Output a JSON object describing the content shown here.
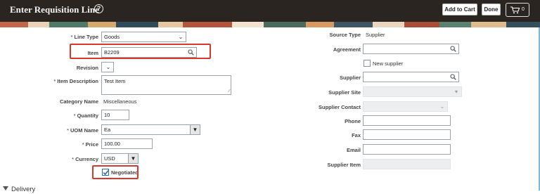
{
  "header": {
    "title": "Enter Requisition Line",
    "add_to_cart": "Add to Cart",
    "done": "Done",
    "cart_count": "0"
  },
  "left": {
    "line_type": {
      "label": "Line Type",
      "value": "Goods"
    },
    "item": {
      "label": "Item",
      "value": "B2209"
    },
    "revision": {
      "label": "Revision",
      "value": ""
    },
    "item_description": {
      "label": "Item Description",
      "value": "Test Item"
    },
    "category_name": {
      "label": "Category Name",
      "value": "Miscellaneous"
    },
    "quantity": {
      "label": "Quantity",
      "value": "10"
    },
    "uom_name": {
      "label": "UOM Name",
      "value": "Ea"
    },
    "price": {
      "label": "Price",
      "value": "100.00"
    },
    "currency": {
      "label": "Currency",
      "value": "USD"
    },
    "negotiated": {
      "label": "Negotiated",
      "checked": true
    }
  },
  "right": {
    "source_type": {
      "label": "Source Type",
      "value": "Supplier"
    },
    "agreement": {
      "label": "Agreement",
      "value": ""
    },
    "new_supplier": {
      "label": "New supplier",
      "checked": false
    },
    "supplier": {
      "label": "Supplier",
      "value": ""
    },
    "supplier_site": {
      "label": "Supplier Site",
      "value": ""
    },
    "supplier_contact": {
      "label": "Supplier Contact",
      "value": ""
    },
    "phone": {
      "label": "Phone",
      "value": ""
    },
    "fax": {
      "label": "Fax",
      "value": ""
    },
    "email": {
      "label": "Email",
      "value": ""
    },
    "supplier_item": {
      "label": "Supplier Item",
      "value": ""
    }
  },
  "sections": {
    "delivery": "Delivery"
  },
  "colors": {
    "header_bg": "#2b2521",
    "highlight": "#d9372c",
    "check": "#2b6cb3"
  }
}
